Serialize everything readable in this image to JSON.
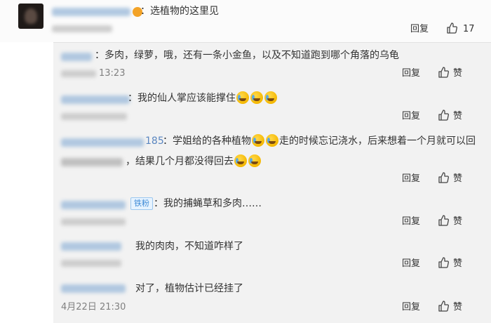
{
  "main_comment": {
    "text": "：选植物的这里见",
    "reply_label": "回复",
    "like_count": "17"
  },
  "replies": [
    {
      "text": "：多肉，绿萝，哦，还有一条小金鱼，以及不知道跑到哪个角落的乌龟",
      "time_tail": "13:23",
      "reply_label": "回复",
      "like_label": "赞"
    },
    {
      "text": "：我的仙人掌应该能撑住",
      "reply_label": "回复",
      "like_label": "赞"
    },
    {
      "name_tail": "185",
      "text_a": "：学姐给的各种植物",
      "text_b": "走的时候忘记浇水，后来想着一个月就可以回",
      "text_c": "，结果几个月都没得回去",
      "reply_label": "回复",
      "like_label": "赞"
    },
    {
      "badge": "铁粉",
      "text": "：我的捕蝇草和多肉……",
      "reply_label": "回复",
      "like_label": "赞"
    },
    {
      "text": "我的肉肉，不知道咋样了",
      "reply_label": "回复",
      "like_label": "赞"
    },
    {
      "text": "对了，植物估计已经挂了",
      "time": "4月22日 21:30",
      "reply_label": "回复",
      "like_label": "赞"
    }
  ]
}
